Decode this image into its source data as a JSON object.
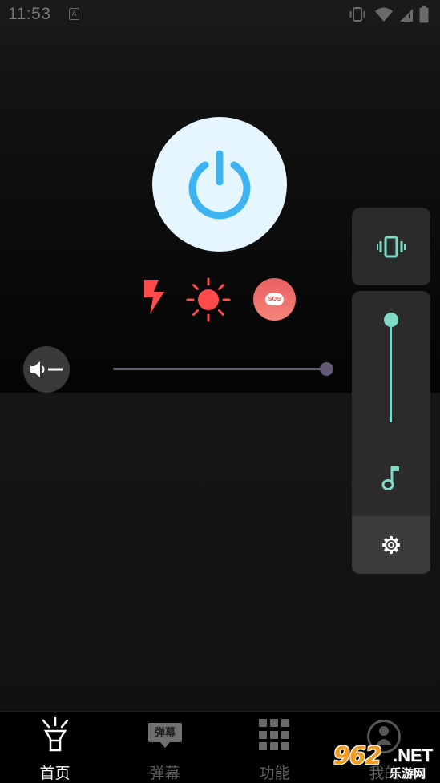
{
  "status_bar": {
    "time": "11:53",
    "notification_icon_letter": "A",
    "icons": [
      "vibrate-icon",
      "wifi-icon",
      "signal-icon",
      "battery-icon"
    ]
  },
  "controls": {
    "power_icon": "power-icon",
    "power_color": "#3db4f2",
    "mode_icons": [
      "lightning-icon",
      "sun-icon",
      "sos-icon"
    ],
    "mode_color": "#ff4b4b",
    "sos_label": "SOS",
    "volume_icon": "speaker-icon",
    "volume_level": 1.0
  },
  "side_panel": {
    "vibrate_icon": "vibrate-icon",
    "slider_level": 1.0,
    "music_icon": "music-note-icon",
    "settings_icon": "gear-icon",
    "accent_color": "#7fd9c7"
  },
  "nav": {
    "items": [
      {
        "label": "首页",
        "icon": "flashlight-icon",
        "active": true
      },
      {
        "label": "弹幕",
        "icon": "danmu-icon",
        "icon_text": "弹幕",
        "active": false
      },
      {
        "label": "功能",
        "icon": "grid-icon",
        "active": false
      },
      {
        "label": "我的",
        "icon": "profile-icon",
        "active": false
      }
    ]
  },
  "watermark": {
    "number": "962",
    "suffix": ".NET",
    "chinese": "乐游网"
  }
}
